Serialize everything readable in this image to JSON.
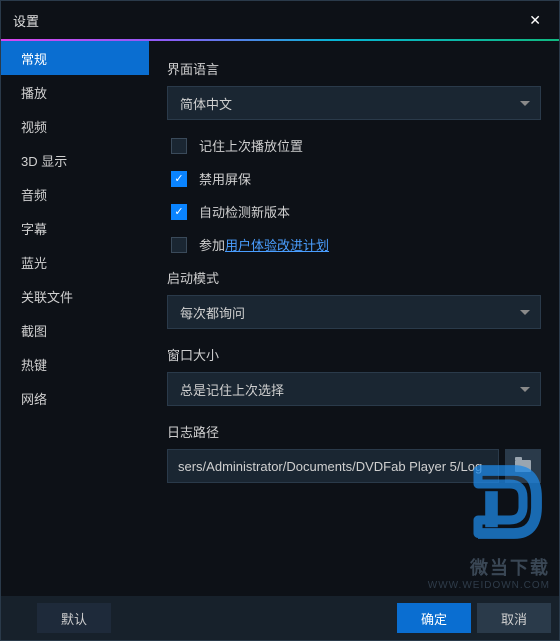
{
  "titlebar": {
    "title": "设置"
  },
  "sidebar": {
    "items": [
      {
        "label": "常规",
        "active": true
      },
      {
        "label": "播放"
      },
      {
        "label": "视频"
      },
      {
        "label": "3D 显示"
      },
      {
        "label": "音频"
      },
      {
        "label": "字幕"
      },
      {
        "label": "蓝光"
      },
      {
        "label": "关联文件"
      },
      {
        "label": "截图"
      },
      {
        "label": "热键"
      },
      {
        "label": "网络"
      }
    ]
  },
  "main": {
    "lang_label": "界面语言",
    "lang_value": "简体中文",
    "chk_remember": {
      "label": "记住上次播放位置",
      "checked": false
    },
    "chk_screensaver": {
      "label": "禁用屏保",
      "checked": true
    },
    "chk_update": {
      "label": "自动检测新版本",
      "checked": true
    },
    "chk_ux": {
      "prefix": "参加",
      "link": "用户体验改进计划",
      "checked": false
    },
    "launch_label": "启动模式",
    "launch_value": "每次都询问",
    "winsize_label": "窗口大小",
    "winsize_value": "总是记住上次选择",
    "logpath_label": "日志路径",
    "logpath_value": "sers/Administrator/Documents/DVDFab Player 5/Log"
  },
  "footer": {
    "default_label": "默认",
    "ok_label": "确定",
    "cancel_label": "取消"
  },
  "watermark": {
    "text1": "微当下载",
    "text2": "WWW.WEIDOWN.COM"
  }
}
